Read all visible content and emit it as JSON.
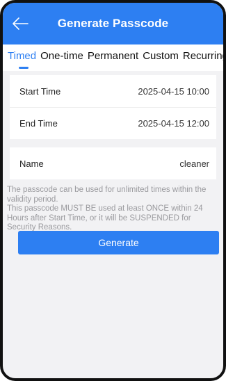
{
  "header": {
    "title": "Generate Passcode"
  },
  "tabs": [
    {
      "label": "Timed"
    },
    {
      "label": "One-time"
    },
    {
      "label": "Permanent"
    },
    {
      "label": "Custom"
    },
    {
      "label": "Recurring"
    }
  ],
  "time_card": {
    "start_label": "Start Time",
    "start_value": "2025-04-15 10:00",
    "end_label": "End Time",
    "end_value": "2025-04-15 12:00"
  },
  "name_card": {
    "label": "Name",
    "value": "cleaner"
  },
  "info": {
    "line1": "The passcode can be used for unlimited times within the validity period.",
    "line2": "This passcode MUST BE used at least ONCE within 24 Hours after Start Time, or it will be SUSPENDED for Security Reasons."
  },
  "generate_button": {
    "label": "Generate"
  },
  "colors": {
    "accent": "#2d7ff2",
    "background": "#f2f2f4",
    "hint_text": "#9a9a9e"
  },
  "icons": {
    "back": "arrow-left-icon"
  }
}
